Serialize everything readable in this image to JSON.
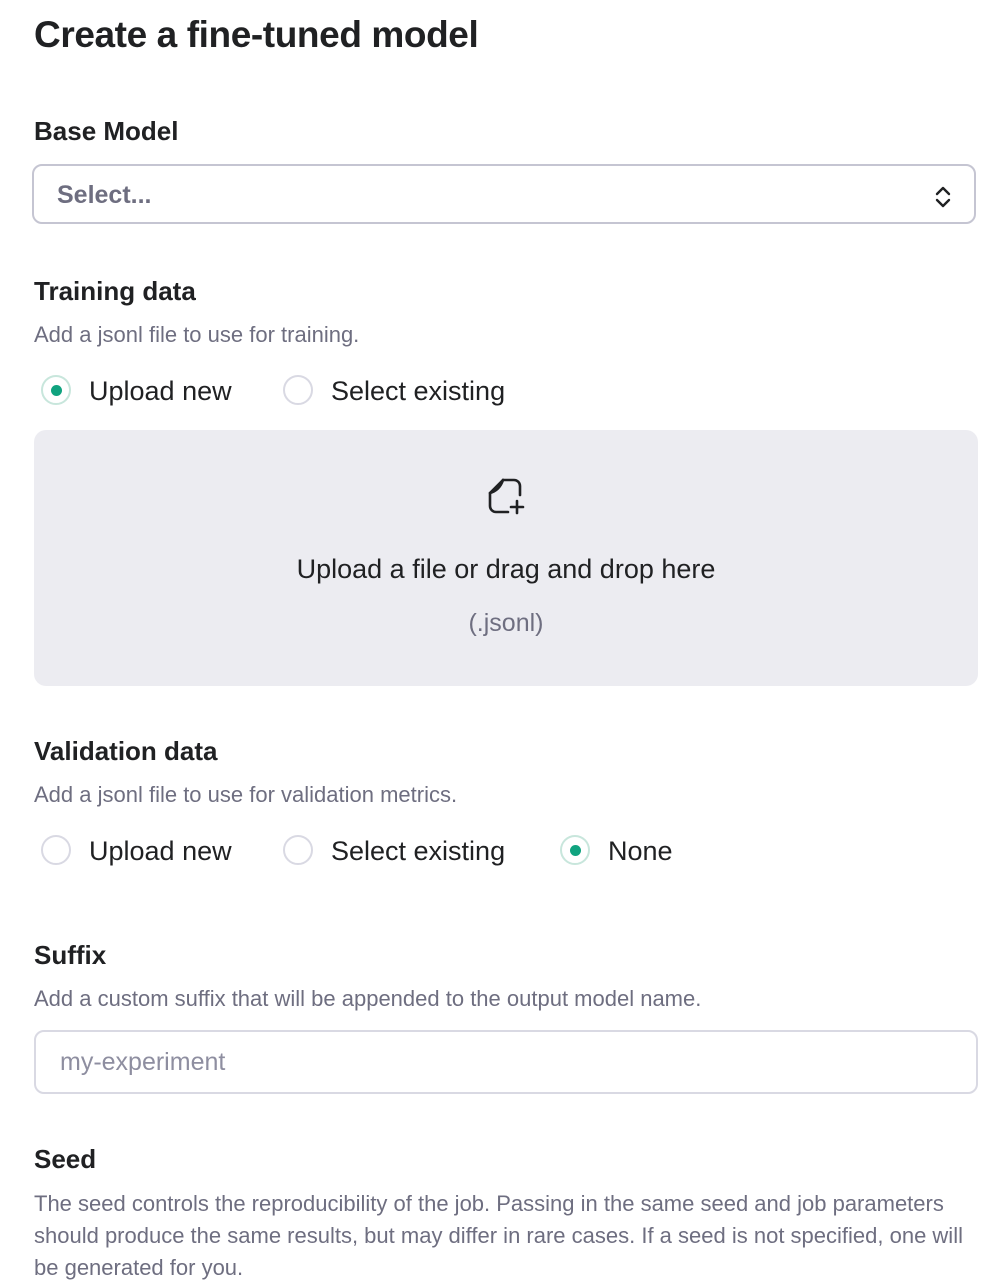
{
  "page": {
    "title": "Create a fine-tuned model"
  },
  "base_model": {
    "heading": "Base Model",
    "select_value": "Select...",
    "chevron_icon": "chevron-up-down-icon"
  },
  "training": {
    "heading": "Training data",
    "helper": "Add a jsonl file to use for training.",
    "options": [
      {
        "label": "Upload new",
        "checked": true
      },
      {
        "label": "Select existing",
        "checked": false
      }
    ],
    "dropzone": {
      "icon": "file-plus-icon",
      "text": "Upload a file or drag and drop here",
      "subtext": "(.jsonl)"
    }
  },
  "validation": {
    "heading": "Validation data",
    "helper": "Add a jsonl file to use for validation metrics.",
    "options": [
      {
        "label": "Upload new",
        "checked": false
      },
      {
        "label": "Select existing",
        "checked": false
      },
      {
        "label": "None",
        "checked": true
      }
    ]
  },
  "suffix": {
    "heading": "Suffix",
    "helper": "Add a custom suffix that will be appended to the output model name.",
    "value": "",
    "placeholder": "my-experiment"
  },
  "seed": {
    "heading": "Seed",
    "description": "The seed controls the reproducibility of the job. Passing in the same seed and job parameters should produce the same results, but may differ in rare cases. If a seed is not specified, one will be generated for you."
  },
  "colors": {
    "accent": "#10a37f",
    "text": "#202123",
    "muted": "#6e6e80",
    "dropzone_bg": "#ececf1",
    "border": "#c5c5d2"
  }
}
